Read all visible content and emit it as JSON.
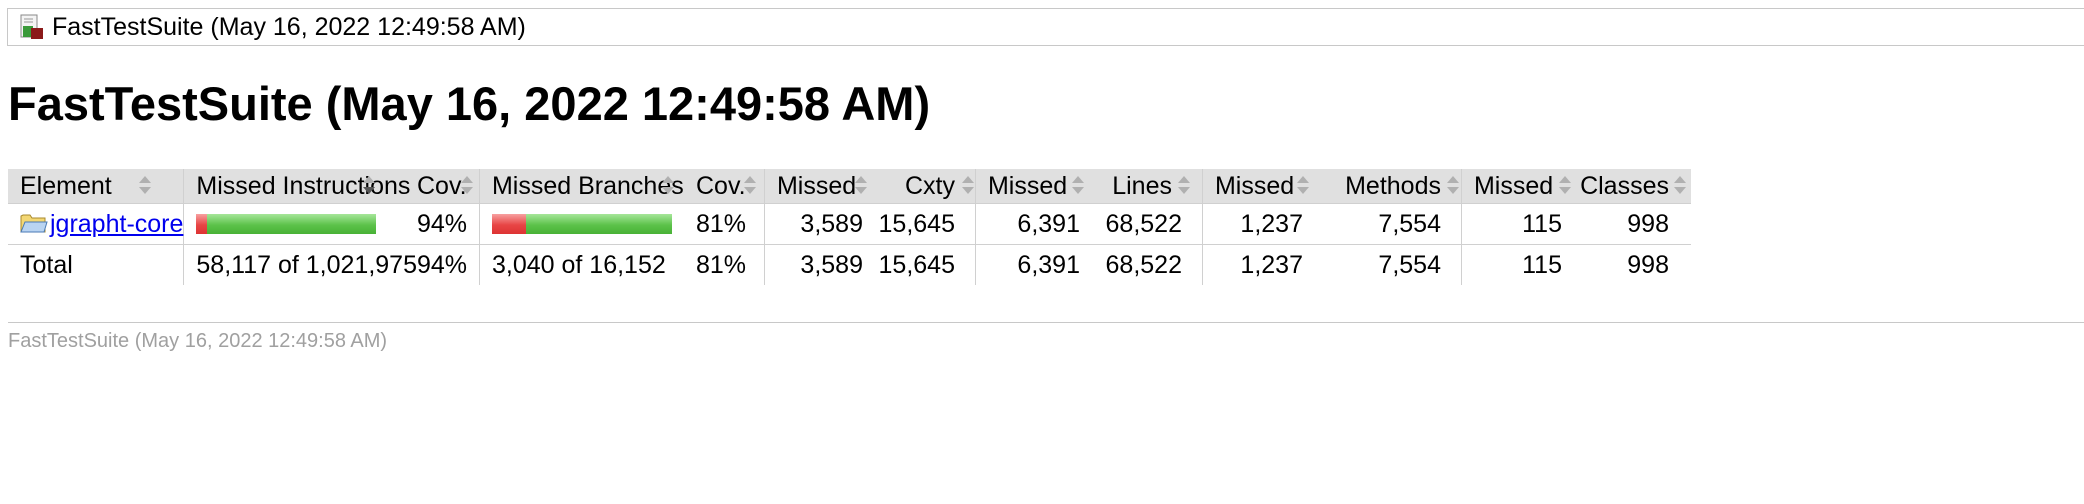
{
  "breadcrumb": {
    "icon": "report-icon",
    "title": "FastTestSuite (May 16, 2022 12:49:58 AM)"
  },
  "page_title": "FastTestSuite (May 16, 2022 12:49:58 AM)",
  "table": {
    "headers": {
      "element": "Element",
      "missed_instructions": "Missed Instructions",
      "cov_instructions": "Cov.",
      "missed_branches": "Missed Branches",
      "cov_branches": "Cov.",
      "missed_cxty": "Missed",
      "cxty": "Cxty",
      "missed_lines": "Missed",
      "lines": "Lines",
      "missed_methods": "Missed",
      "methods": "Methods",
      "missed_classes": "Missed",
      "classes": "Classes"
    },
    "sorted_column": "missed_instructions",
    "rows": [
      {
        "element": "jgrapht-core",
        "element_icon": "folder-icon",
        "instructions_missed_fraction": 0.06,
        "cov_instructions": "94%",
        "branches_missed_fraction": 0.19,
        "cov_branches": "81%",
        "missed_cxty": "3,589",
        "cxty": "15,645",
        "missed_lines": "6,391",
        "lines": "68,522",
        "missed_methods": "1,237",
        "methods": "7,554",
        "missed_classes": "115",
        "classes": "998"
      }
    ],
    "total": {
      "element": "Total",
      "missed_instructions": "58,117 of 1,021,975",
      "cov_instructions": "94%",
      "missed_branches": "3,040 of 16,152",
      "cov_branches": "81%",
      "missed_cxty": "3,589",
      "cxty": "15,645",
      "missed_lines": "6,391",
      "lines": "68,522",
      "missed_methods": "1,237",
      "methods": "7,554",
      "missed_classes": "115",
      "classes": "998"
    }
  },
  "footer": "FastTestSuite (May 16, 2022 12:49:58 AM)",
  "colors": {
    "bar_missed": "#e84545",
    "bar_covered": "#5cc24a",
    "header_bg": "#e0e0e0",
    "link": "#0000ee"
  }
}
